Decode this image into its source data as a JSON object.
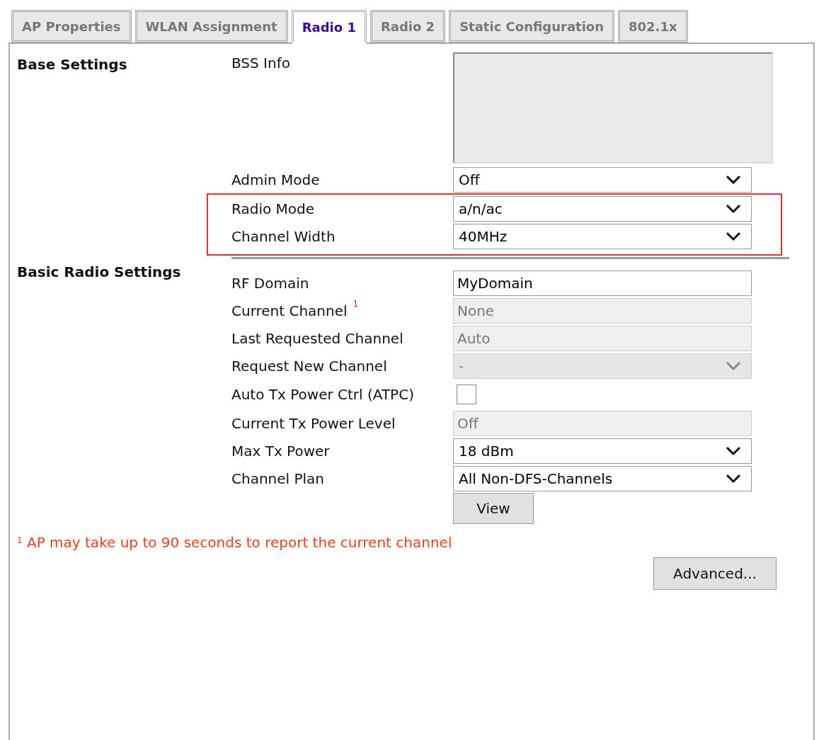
{
  "tabs": [
    {
      "label": "AP Properties",
      "selected": false
    },
    {
      "label": "WLAN Assignment",
      "selected": false
    },
    {
      "label": "Radio 1",
      "selected": true
    },
    {
      "label": "Radio 2",
      "selected": false
    },
    {
      "label": "Static Configuration",
      "selected": false
    },
    {
      "label": "802.1x",
      "selected": false
    }
  ],
  "sections": [
    {
      "title": "Base Settings",
      "rows": [
        {
          "label": "BSS Info",
          "kind": "textarea",
          "highlighted": false
        },
        {
          "label": "Admin Mode",
          "kind": "select",
          "value": "Off",
          "disabled": false,
          "highlighted": false
        },
        {
          "label": "Radio Mode",
          "kind": "select",
          "value": "a/n/ac",
          "disabled": false,
          "highlighted": true
        },
        {
          "label": "Channel Width",
          "kind": "select",
          "value": "40MHz",
          "disabled": false,
          "highlighted": true
        }
      ]
    },
    {
      "title": "Basic Radio Settings",
      "rows": [
        {
          "label": "RF Domain",
          "kind": "text",
          "value": "MyDomain",
          "disabled": false,
          "highlighted": false
        },
        {
          "label": "Current Channel",
          "note_mark": "1",
          "kind": "text",
          "value": "None",
          "disabled": true,
          "highlighted": false
        },
        {
          "label": "Last Requested Channel",
          "kind": "text",
          "value": "Auto",
          "disabled": true,
          "highlighted": false
        },
        {
          "label": "Request New Channel",
          "kind": "select",
          "value": "-",
          "disabled": true,
          "highlighted": false
        },
        {
          "label": "Auto Tx Power Ctrl (ATPC)",
          "kind": "checkbox",
          "checked": false,
          "highlighted": false
        },
        {
          "label": "Current Tx Power Level",
          "kind": "text",
          "value": "Off",
          "disabled": true,
          "highlighted": false
        },
        {
          "label": "Max Tx Power",
          "kind": "select",
          "value": "18 dBm",
          "disabled": false,
          "highlighted": false
        },
        {
          "label": "Channel Plan",
          "kind": "select",
          "value": "All Non-DFS-Channels",
          "disabled": false,
          "highlighted": false
        },
        {
          "kind": "button",
          "label": "View",
          "highlighted": false
        }
      ]
    }
  ],
  "footnote": {
    "mark": "1",
    "text": "AP may take up to 90 seconds to report the current channel"
  },
  "advanced_button": "Advanced..."
}
